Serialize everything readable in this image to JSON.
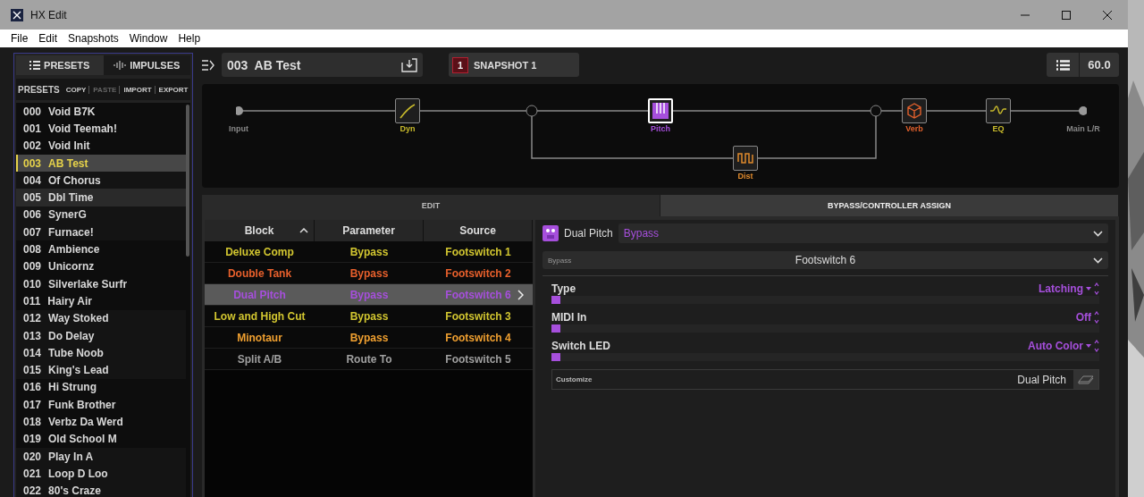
{
  "window": {
    "title": "HX Edit"
  },
  "menu": [
    "File",
    "Edit",
    "Snapshots",
    "Window",
    "Help"
  ],
  "library_tabs": [
    {
      "label": "PRESETS",
      "selected": true
    },
    {
      "label": "IMPULSES",
      "selected": false
    }
  ],
  "presets_toolbar": {
    "title": "PRESETS",
    "actions": [
      {
        "label": "COPY",
        "disabled": false
      },
      {
        "label": "PASTE",
        "disabled": true
      },
      {
        "label": "IMPORT",
        "disabled": false
      },
      {
        "label": "EXPORT",
        "disabled": false
      }
    ]
  },
  "presets": [
    {
      "number": "000",
      "name": "Void B7K",
      "selected": false,
      "hover": false
    },
    {
      "number": "001",
      "name": "Void Teemah!",
      "selected": false,
      "hover": false
    },
    {
      "number": "002",
      "name": "Void Init",
      "selected": false,
      "hover": false
    },
    {
      "number": "003",
      "name": "AB Test",
      "selected": true,
      "hover": false
    },
    {
      "number": "004",
      "name": "Of Chorus",
      "selected": false,
      "hover": false
    },
    {
      "number": "005",
      "name": "Dbl Time",
      "selected": false,
      "hover": true
    },
    {
      "number": "006",
      "name": "SynerG",
      "selected": false,
      "hover": false
    },
    {
      "number": "007",
      "name": "Furnace!",
      "selected": false,
      "hover": false
    },
    {
      "number": "008",
      "name": "Ambience",
      "selected": false,
      "hover": false
    },
    {
      "number": "009",
      "name": "Unicornz",
      "selected": false,
      "hover": false
    },
    {
      "number": "010",
      "name": "Silverlake Surfr",
      "selected": false,
      "hover": false
    },
    {
      "number": "011",
      "name": "Hairy Air",
      "selected": false,
      "hover": false
    },
    {
      "number": "012",
      "name": "Way Stoked",
      "selected": false,
      "hover": false
    },
    {
      "number": "013",
      "name": "Do Delay",
      "selected": false,
      "hover": false
    },
    {
      "number": "014",
      "name": "Tube Noob",
      "selected": false,
      "hover": false
    },
    {
      "number": "015",
      "name": "King's Lead",
      "selected": false,
      "hover": false
    },
    {
      "number": "016",
      "name": "Hi Strung",
      "selected": false,
      "hover": false
    },
    {
      "number": "017",
      "name": "Funk Brother",
      "selected": false,
      "hover": false
    },
    {
      "number": "018",
      "name": "Verbz Da Werd",
      "selected": false,
      "hover": false
    },
    {
      "number": "019",
      "name": "Old School M",
      "selected": false,
      "hover": false
    },
    {
      "number": "020",
      "name": "Play In A",
      "selected": false,
      "hover": false
    },
    {
      "number": "021",
      "name": "Loop D Loo",
      "selected": false,
      "hover": false
    },
    {
      "number": "022",
      "name": "80's Craze",
      "selected": false,
      "hover": false
    }
  ],
  "preset_name": "003  AB Test",
  "snapshot": {
    "number": "1",
    "label": "SNAPSHOT 1"
  },
  "tempo": "60.0",
  "signal_chain": {
    "input": "Input",
    "output": "Main L/R",
    "blocks": [
      {
        "label": "Dyn",
        "kind": "dynamics",
        "color": "#c9bb2c",
        "selected": false
      },
      {
        "label": "Pitch",
        "kind": "pitch",
        "color": "#a64fdc",
        "selected": true
      },
      {
        "label": "Dist",
        "kind": "distortion",
        "color": "#e08a2c",
        "selected": false
      },
      {
        "label": "Verb",
        "kind": "reverb",
        "color": "#e0602c",
        "selected": false
      },
      {
        "label": "EQ",
        "kind": "eq",
        "color": "#c9bb2c",
        "selected": false
      }
    ]
  },
  "edit_tabs": [
    {
      "label": "EDIT",
      "selected": false
    },
    {
      "label": "BYPASS/CONTROLLER ASSIGN",
      "selected": true
    }
  ],
  "assign_table": {
    "columns": [
      "Block",
      "Parameter",
      "Source"
    ],
    "rows": [
      {
        "block": "Deluxe Comp",
        "parameter": "Bypass",
        "source": "Footswitch 1",
        "color": "#d2c630",
        "selected": false
      },
      {
        "block": "Double Tank",
        "parameter": "Bypass",
        "source": "Footswitch 2",
        "color": "#e8602c",
        "selected": false
      },
      {
        "block": "Dual Pitch",
        "parameter": "Bypass",
        "source": "Footswitch 6",
        "color": "#a64fdc",
        "selected": true
      },
      {
        "block": "Low and High Cut",
        "parameter": "Bypass",
        "source": "Footswitch 3",
        "color": "#d2c630",
        "selected": false
      },
      {
        "block": "Minotaur",
        "parameter": "Bypass",
        "source": "Footswitch 4",
        "color": "#f0a030",
        "selected": false
      },
      {
        "block": "Split A/B",
        "parameter": "Route To",
        "source": "Footswitch 5",
        "color": "#a0a0a0",
        "selected": false
      }
    ]
  },
  "controller": {
    "block": "Dual Pitch",
    "parameter": "Bypass",
    "source_label": "Bypass",
    "source": "Footswitch 6",
    "settings": [
      {
        "label": "Type",
        "value": "Latching",
        "kind": "dropdown",
        "level": 0
      },
      {
        "label": "MIDI In",
        "value": "Off",
        "kind": "toggle",
        "level": 0
      },
      {
        "label": "Switch LED",
        "value": "Auto Color",
        "kind": "dropdown",
        "level": 0
      }
    ],
    "customize": {
      "label": "Customize",
      "value": "Dual Pitch"
    }
  }
}
